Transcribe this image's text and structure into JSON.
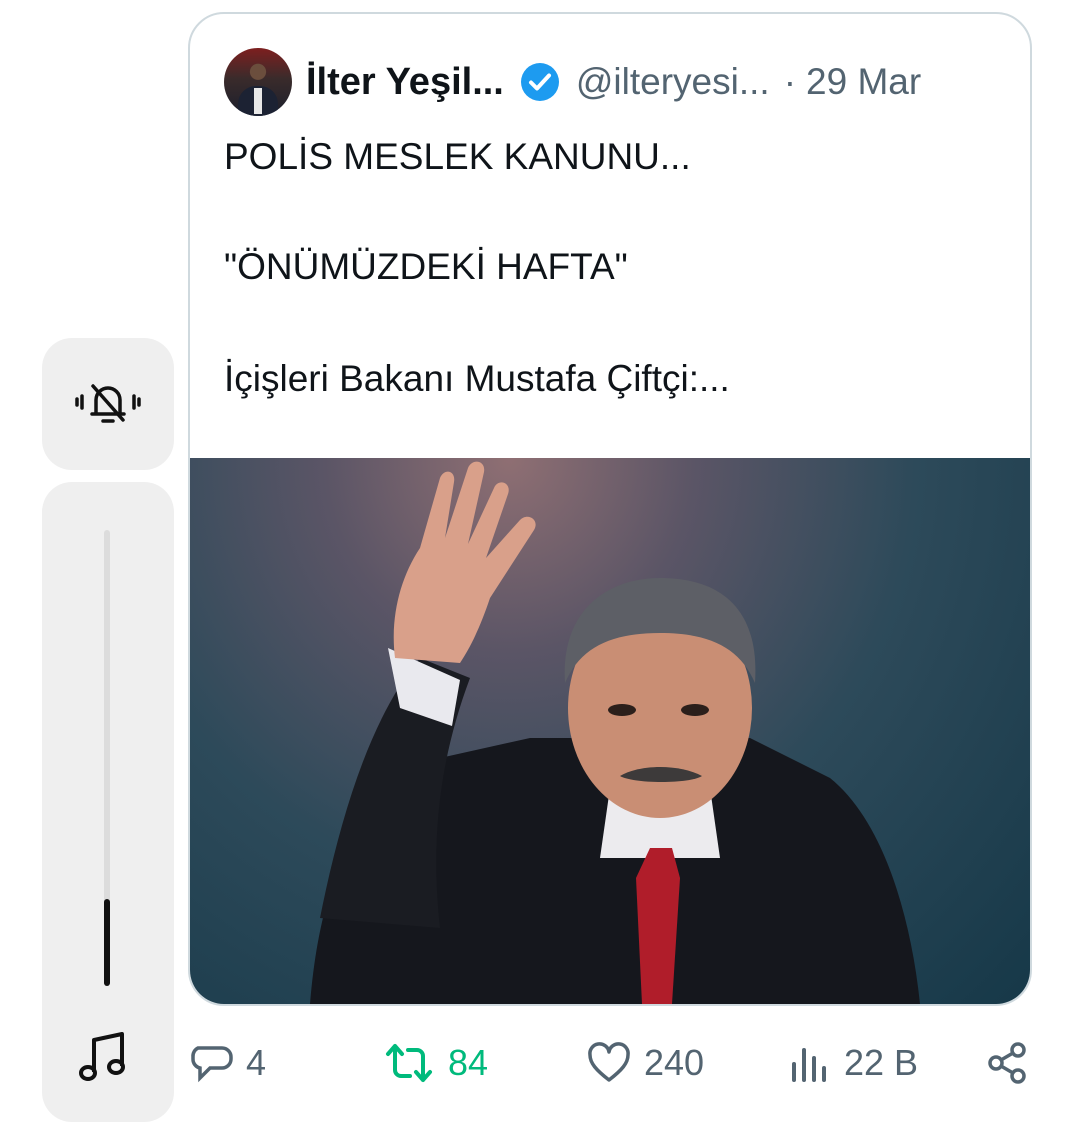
{
  "tweet": {
    "author_name": "İlter Yeşil...",
    "handle": "@ilteryesi...",
    "separator": "·",
    "date": "29 Mar",
    "text_lines": [
      "POLİS MESLEK KANUNU...",
      "\"ÖNÜMÜZDEKİ HAFTA\"",
      "İçişleri Bakanı Mustafa Çiftçi:..."
    ]
  },
  "actions": {
    "replies": "4",
    "retweets": "84",
    "likes": "240",
    "views": "22 B"
  },
  "system_overlay": {
    "ringer_icon": "bell-off-vibrate-icon",
    "volume_level": 0.19,
    "media_icon": "music-note-icon"
  },
  "colors": {
    "verified": "#1d9bf0",
    "retweet_active": "#00ba7c",
    "muted_text": "#536471",
    "border": "#cfd9de"
  }
}
